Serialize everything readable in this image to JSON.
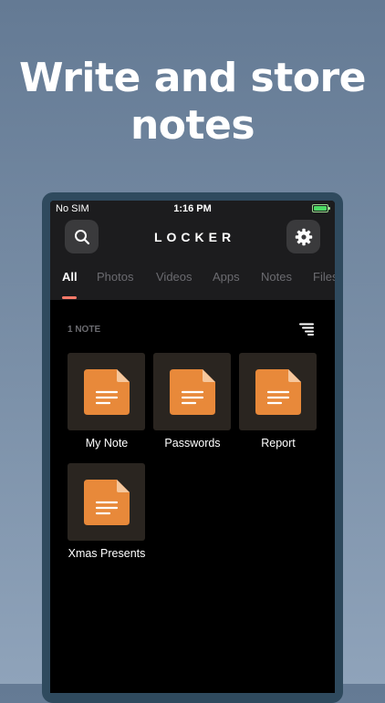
{
  "headline": {
    "line1": "Write and store",
    "line2": "notes"
  },
  "status_bar": {
    "carrier": "No SIM",
    "time": "1:16 PM"
  },
  "app": {
    "brand": "LOCKER"
  },
  "tabs": [
    {
      "label": "All",
      "active": true
    },
    {
      "label": "Photos",
      "active": false
    },
    {
      "label": "Videos",
      "active": false
    },
    {
      "label": "Apps",
      "active": false
    },
    {
      "label": "Notes",
      "active": false
    },
    {
      "label": "Files",
      "active": false
    }
  ],
  "content": {
    "count_label": "1 NOTE"
  },
  "files": [
    {
      "name": "My Note",
      "icon": "note-file-icon"
    },
    {
      "name": "Passwords",
      "icon": "note-file-icon"
    },
    {
      "name": "Report",
      "icon": "note-file-icon"
    },
    {
      "name": "Xmas Presents",
      "icon": "note-file-icon"
    }
  ],
  "colors": {
    "background": "#6f849d",
    "device_frame": "#2f4a5e",
    "accent": "#ff7a6a",
    "file_icon": "#e8893a",
    "file_icon_fold": "#f6c79c"
  }
}
